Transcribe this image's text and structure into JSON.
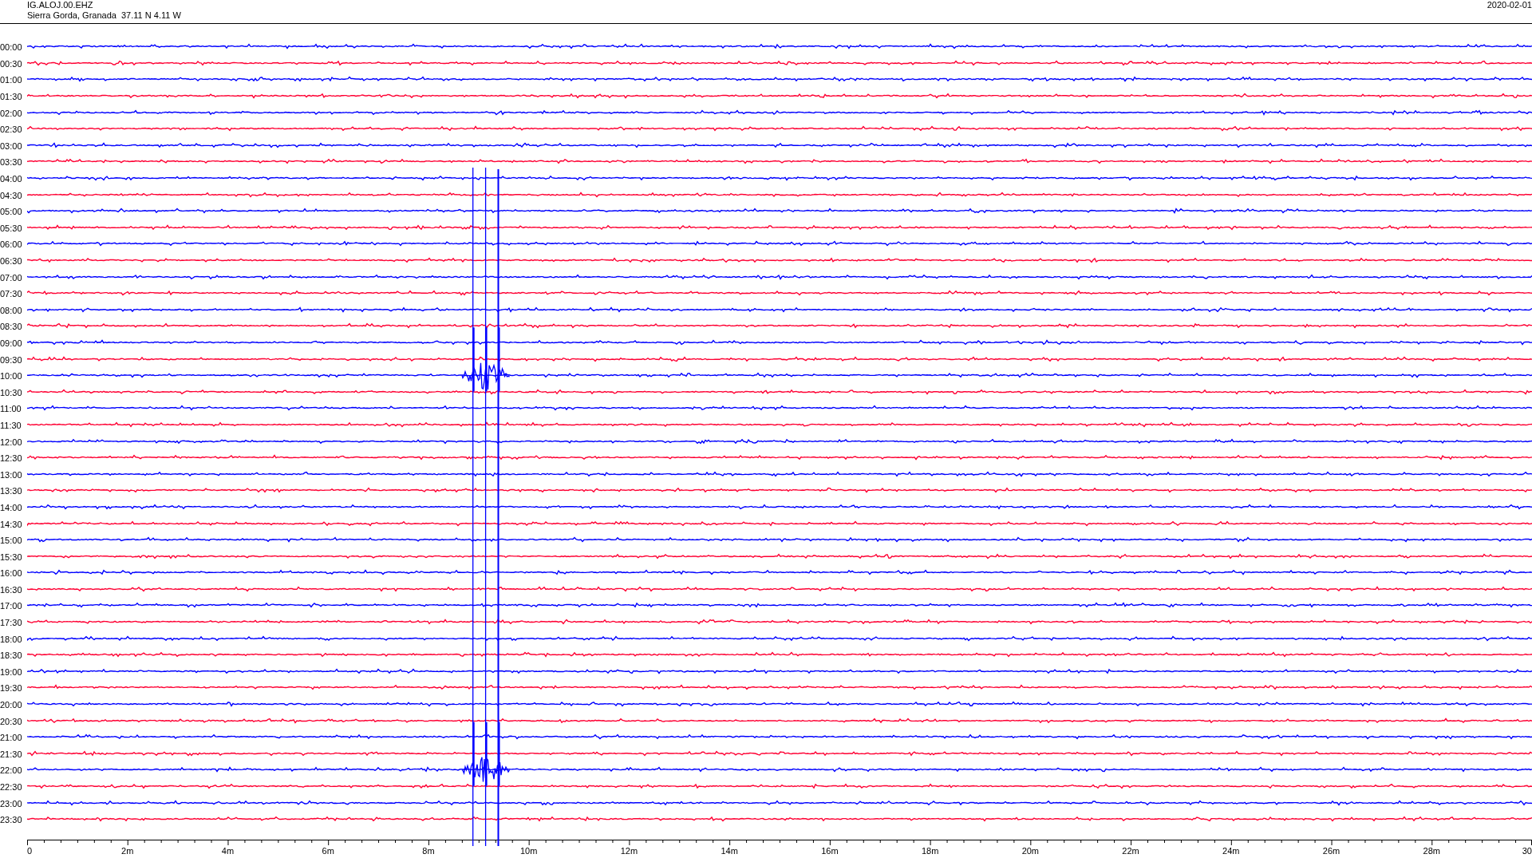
{
  "header": {
    "station": "IG.ALOJ.00.EHZ",
    "location": "Sierra Gorda, Granada  37.11 N 4.11 W",
    "date": "2020-02-01"
  },
  "rows": [
    {
      "time": "00:00",
      "color": "#0000ff"
    },
    {
      "time": "00:30",
      "color": "#ff0033"
    },
    {
      "time": "01:00",
      "color": "#0000ff"
    },
    {
      "time": "01:30",
      "color": "#ff0033"
    },
    {
      "time": "02:00",
      "color": "#0000ff"
    },
    {
      "time": "02:30",
      "color": "#ff0033"
    },
    {
      "time": "03:00",
      "color": "#0000ff"
    },
    {
      "time": "03:30",
      "color": "#ff0033"
    },
    {
      "time": "04:00",
      "color": "#0000ff"
    },
    {
      "time": "04:30",
      "color": "#ff0033"
    },
    {
      "time": "05:00",
      "color": "#0000ff"
    },
    {
      "time": "05:30",
      "color": "#ff0033"
    },
    {
      "time": "06:00",
      "color": "#0000ff"
    },
    {
      "time": "06:30",
      "color": "#ff0033"
    },
    {
      "time": "07:00",
      "color": "#0000ff"
    },
    {
      "time": "07:30",
      "color": "#ff0033"
    },
    {
      "time": "08:00",
      "color": "#0000ff"
    },
    {
      "time": "08:30",
      "color": "#ff0033"
    },
    {
      "time": "09:00",
      "color": "#0000ff"
    },
    {
      "time": "09:30",
      "color": "#ff0033"
    },
    {
      "time": "10:00",
      "color": "#0000ff"
    },
    {
      "time": "10:30",
      "color": "#ff0033"
    },
    {
      "time": "11:00",
      "color": "#0000ff"
    },
    {
      "time": "11:30",
      "color": "#ff0033"
    },
    {
      "time": "12:00",
      "color": "#0000ff"
    },
    {
      "time": "12:30",
      "color": "#ff0033"
    },
    {
      "time": "13:00",
      "color": "#0000ff"
    },
    {
      "time": "13:30",
      "color": "#ff0033"
    },
    {
      "time": "14:00",
      "color": "#0000ff"
    },
    {
      "time": "14:30",
      "color": "#ff0033"
    },
    {
      "time": "15:00",
      "color": "#0000ff"
    },
    {
      "time": "15:30",
      "color": "#ff0033"
    },
    {
      "time": "16:00",
      "color": "#0000ff"
    },
    {
      "time": "16:30",
      "color": "#ff0033"
    },
    {
      "time": "17:00",
      "color": "#0000ff"
    },
    {
      "time": "17:30",
      "color": "#ff0033"
    },
    {
      "time": "18:00",
      "color": "#0000ff"
    },
    {
      "time": "18:30",
      "color": "#ff0033"
    },
    {
      "time": "19:00",
      "color": "#0000ff"
    },
    {
      "time": "19:30",
      "color": "#ff0033"
    },
    {
      "time": "20:00",
      "color": "#0000ff"
    },
    {
      "time": "20:30",
      "color": "#ff0033"
    },
    {
      "time": "21:00",
      "color": "#0000ff"
    },
    {
      "time": "21:30",
      "color": "#ff0033"
    },
    {
      "time": "22:00",
      "color": "#0000ff"
    },
    {
      "time": "22:30",
      "color": "#ff0033"
    },
    {
      "time": "23:00",
      "color": "#0000ff"
    },
    {
      "time": "23:30",
      "color": "#ff0033"
    }
  ],
  "axis": {
    "ticks": [
      "0",
      "2m",
      "4m",
      "6m",
      "8m",
      "10m",
      "12m",
      "14m",
      "16m",
      "18m",
      "20m",
      "22m",
      "24m",
      "26m",
      "28m",
      "30"
    ]
  }
}
